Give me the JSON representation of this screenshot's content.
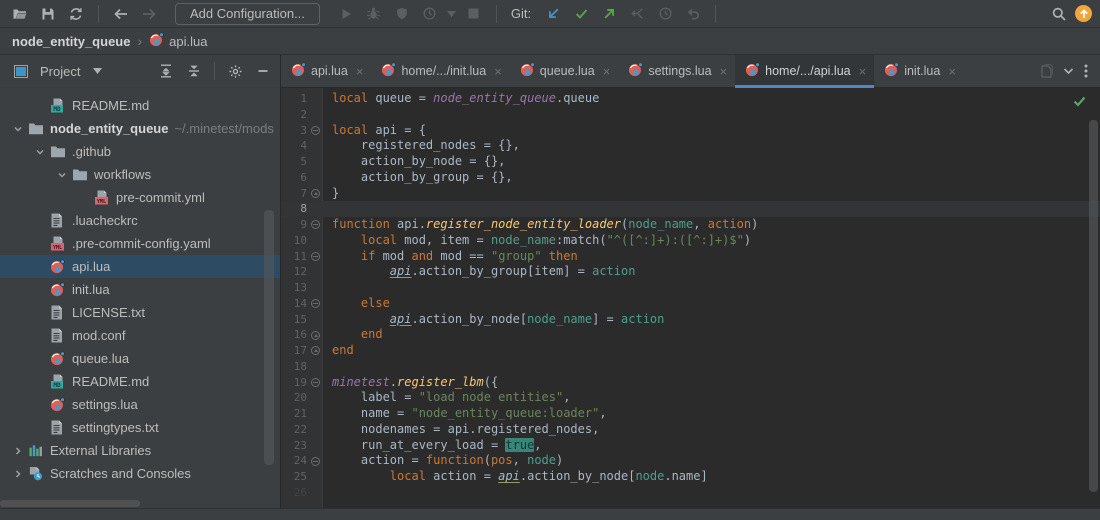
{
  "toolbar": {
    "add_configuration_label": "Add Configuration...",
    "git_label": "Git:"
  },
  "breadcrumb": {
    "project": "node_entity_queue",
    "separator": "›",
    "file": "api.lua"
  },
  "project_panel": {
    "title": "Project",
    "tree": [
      {
        "label": "README.md",
        "icon": "md",
        "depth": 1
      },
      {
        "label": "node_entity_queue",
        "icon": "folder",
        "depth": 0,
        "chevron": "down",
        "bold": true,
        "hint": "~/.minetest/mods"
      },
      {
        "label": ".github",
        "icon": "folder",
        "depth": 1,
        "chevron": "down"
      },
      {
        "label": "workflows",
        "icon": "folder",
        "depth": 2,
        "chevron": "down"
      },
      {
        "label": "pre-commit.yml",
        "icon": "yml",
        "depth": 3
      },
      {
        "label": ".luacheckrc",
        "icon": "txt",
        "depth": 1
      },
      {
        "label": ".pre-commit-config.yaml",
        "icon": "yml",
        "depth": 1
      },
      {
        "label": "api.lua",
        "icon": "lua",
        "depth": 1,
        "selected": true
      },
      {
        "label": "init.lua",
        "icon": "lua",
        "depth": 1
      },
      {
        "label": "LICENSE.txt",
        "icon": "txt",
        "depth": 1
      },
      {
        "label": "mod.conf",
        "icon": "txt",
        "depth": 1
      },
      {
        "label": "queue.lua",
        "icon": "lua",
        "depth": 1
      },
      {
        "label": "README.md",
        "icon": "md",
        "depth": 1
      },
      {
        "label": "settings.lua",
        "icon": "lua",
        "depth": 1
      },
      {
        "label": "settingtypes.txt",
        "icon": "txt",
        "depth": 1
      },
      {
        "label": "External Libraries",
        "icon": "lib",
        "depth": 0,
        "chevron": "right"
      },
      {
        "label": "Scratches and Consoles",
        "icon": "scratch",
        "depth": 0,
        "chevron": "right"
      }
    ]
  },
  "editor_tabs": [
    {
      "label": "api.lua"
    },
    {
      "label": "home/.../init.lua"
    },
    {
      "label": "queue.lua"
    },
    {
      "label": "settings.lua"
    },
    {
      "label": "home/.../api.lua",
      "active": true
    },
    {
      "label": "init.lua"
    }
  ],
  "editor": {
    "lines": [
      {
        "n": 1,
        "tokens": [
          [
            "kw",
            "local"
          ],
          [
            "pl",
            " queue = "
          ],
          [
            "glob",
            "node_entity_queue"
          ],
          [
            "pl",
            ".queue"
          ]
        ]
      },
      {
        "n": 2,
        "tokens": []
      },
      {
        "n": 3,
        "fold": "start",
        "tokens": [
          [
            "kw",
            "local"
          ],
          [
            "pl",
            " api = {"
          ]
        ]
      },
      {
        "n": 4,
        "tokens": [
          [
            "pl",
            "    registered_nodes = {},"
          ]
        ]
      },
      {
        "n": 5,
        "tokens": [
          [
            "pl",
            "    action_by_node = {},"
          ]
        ]
      },
      {
        "n": 6,
        "tokens": [
          [
            "pl",
            "    action_by_group = {},"
          ]
        ]
      },
      {
        "n": 7,
        "fold": "end",
        "tokens": [
          [
            "pl",
            "}"
          ]
        ]
      },
      {
        "n": 8,
        "current": true,
        "tokens": []
      },
      {
        "n": 9,
        "fold": "start",
        "tokens": [
          [
            "kw",
            "function"
          ],
          [
            "pl",
            " api."
          ],
          [
            "fn",
            "register_node_entity_loader"
          ],
          [
            "pl",
            "("
          ],
          [
            "par",
            "node_name"
          ],
          [
            "pl",
            ", "
          ],
          [
            "kw",
            "action"
          ],
          [
            "pl",
            ")"
          ]
        ]
      },
      {
        "n": 10,
        "tokens": [
          [
            "pl",
            "    "
          ],
          [
            "kw",
            "local"
          ],
          [
            "pl",
            " mod, item = "
          ],
          [
            "par",
            "node_name"
          ],
          [
            "pl",
            ":match("
          ],
          [
            "str",
            "\"^([^:]+):([^:]+)$\""
          ],
          [
            "pl",
            ")"
          ]
        ]
      },
      {
        "n": 11,
        "fold": "start",
        "tokens": [
          [
            "pl",
            "    "
          ],
          [
            "kw",
            "if"
          ],
          [
            "pl",
            " mod "
          ],
          [
            "kw",
            "and"
          ],
          [
            "pl",
            " mod == "
          ],
          [
            "str",
            "\"group\""
          ],
          [
            "pl",
            " "
          ],
          [
            "kw",
            "then"
          ]
        ]
      },
      {
        "n": 12,
        "tokens": [
          [
            "pl",
            "        "
          ],
          [
            "api",
            "api"
          ],
          [
            "pl",
            ".action_by_group[item] = "
          ],
          [
            "par",
            "action"
          ]
        ]
      },
      {
        "n": 13,
        "tokens": []
      },
      {
        "n": 14,
        "fold": "start",
        "tokens": [
          [
            "pl",
            "    "
          ],
          [
            "kw",
            "else"
          ]
        ]
      },
      {
        "n": 15,
        "tokens": [
          [
            "pl",
            "        "
          ],
          [
            "api",
            "api"
          ],
          [
            "pl",
            ".action_by_node["
          ],
          [
            "par",
            "node_name"
          ],
          [
            "pl",
            "] = "
          ],
          [
            "par",
            "action"
          ]
        ]
      },
      {
        "n": 16,
        "fold": "end",
        "tokens": [
          [
            "pl",
            "    "
          ],
          [
            "kw",
            "end"
          ]
        ]
      },
      {
        "n": 17,
        "fold": "end",
        "tokens": [
          [
            "kw",
            "end"
          ]
        ]
      },
      {
        "n": 18,
        "tokens": []
      },
      {
        "n": 19,
        "fold": "start",
        "tokens": [
          [
            "glob",
            "minetest"
          ],
          [
            "pl",
            "."
          ],
          [
            "fn",
            "register_lbm"
          ],
          [
            "pl",
            "({"
          ]
        ]
      },
      {
        "n": 20,
        "tokens": [
          [
            "pl",
            "    label = "
          ],
          [
            "str",
            "\"load node entities\""
          ],
          [
            "pl",
            ","
          ]
        ]
      },
      {
        "n": 21,
        "tokens": [
          [
            "pl",
            "    name = "
          ],
          [
            "str",
            "\"node_entity_queue:loader\""
          ],
          [
            "pl",
            ","
          ]
        ]
      },
      {
        "n": 22,
        "tokens": [
          [
            "pl",
            "    nodenames = api.registered_nodes,"
          ]
        ]
      },
      {
        "n": 23,
        "tokens": [
          [
            "pl",
            "    run_at_every_load = "
          ],
          [
            "tru",
            "true"
          ],
          [
            "pl",
            ","
          ]
        ]
      },
      {
        "n": 24,
        "fold": "start",
        "tokens": [
          [
            "pl",
            "    action = "
          ],
          [
            "kw",
            "function"
          ],
          [
            "pl",
            "("
          ],
          [
            "kw",
            "pos"
          ],
          [
            "pl",
            ", "
          ],
          [
            "par",
            "node"
          ],
          [
            "pl",
            ")"
          ]
        ]
      },
      {
        "n": 25,
        "tokens": [
          [
            "pl",
            "        "
          ],
          [
            "kw",
            "local"
          ],
          [
            "pl",
            " action = "
          ],
          [
            "api",
            "api"
          ],
          [
            "pl",
            ".action_by_node["
          ],
          [
            "par",
            "node"
          ],
          [
            "pl",
            ".name]"
          ]
        ]
      },
      {
        "n": 26,
        "partial": true,
        "tokens": []
      }
    ]
  },
  "colors": {
    "accent_blue": "#4A88C7",
    "selection_blue": "#2D4B63",
    "keyword_orange": "#CC7832",
    "string_green": "#6A8759",
    "function_yellow": "#FFC66D",
    "global_purple": "#9876AA",
    "param_teal": "#4F9E8D",
    "highlight_teal_bg": "#3A8578",
    "git_update_blue": "#3D94C9",
    "git_commit_green": "#57A64A",
    "update_badge_orange": "#EFA63B",
    "inspection_ok_green": "#59A869"
  },
  "icons": [
    "open-project-icon",
    "save-all-icon",
    "sync-icon",
    "back-icon",
    "forward-icon",
    "run-icon",
    "debug-icon",
    "coverage-icon",
    "profiler-icon",
    "dropdown-arrow-icon",
    "stop-icon",
    "git-update-icon",
    "git-commit-icon",
    "git-push-icon",
    "git-cherry-pick-icon",
    "git-history-icon",
    "git-rollback-icon",
    "search-icon",
    "update-badge-icon",
    "tool-window-icon",
    "chevron-down-icon",
    "expand-all-icon",
    "collapse-all-icon",
    "settings-gear-icon",
    "hide-panel-icon",
    "lua-file-icon",
    "md-file-icon",
    "yml-file-icon",
    "text-file-icon",
    "folder-icon",
    "external-libraries-icon",
    "scratches-icon",
    "close-icon",
    "preview-file-icon",
    "more-options-icon",
    "inspections-ok-icon"
  ]
}
